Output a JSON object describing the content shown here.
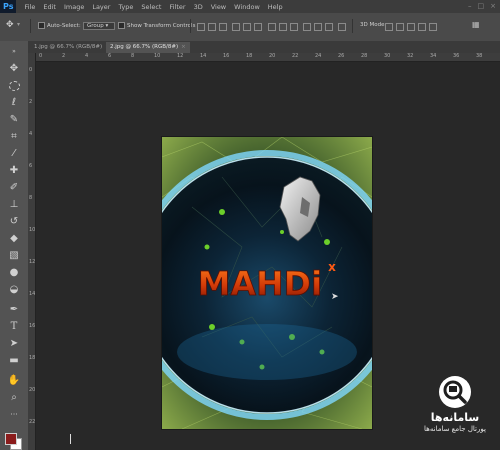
{
  "menubar": {
    "logo": "Ps",
    "items": [
      "File",
      "Edit",
      "Image",
      "Layer",
      "Type",
      "Select",
      "Filter",
      "3D",
      "View",
      "Window",
      "Help"
    ]
  },
  "options": {
    "auto_select_label": "Auto-Select:",
    "auto_select_value": "Group",
    "show_transform_label": "Show Transform Controls",
    "mode_3d_label": "3D Mode:"
  },
  "tabs": [
    {
      "label": "1.jpg @ 66.7% (RGB/8#)",
      "active": false
    },
    {
      "label": "2.jpg @ 66.7% (RGB/8#)",
      "active": true
    }
  ],
  "ruler": {
    "top_ticks": [
      "0",
      "2",
      "4",
      "6",
      "8",
      "10",
      "12",
      "14",
      "16",
      "18",
      "20",
      "22",
      "24",
      "26",
      "28",
      "30",
      "32",
      "34",
      "36",
      "38"
    ],
    "left_ticks": [
      "0",
      "2",
      "4",
      "6",
      "8",
      "10",
      "12",
      "14",
      "16",
      "18",
      "20",
      "22"
    ]
  },
  "artwork": {
    "text": "MAHDi",
    "superscript": "x"
  },
  "watermark": {
    "title": "سامانه‌ها",
    "subtitle": "پورتال جامع سامانه‌ها"
  },
  "colors": {
    "foreground": "#8b1c1c",
    "background": "#ffffff"
  },
  "tools": [
    "move-icon",
    "marquee-icon",
    "lasso-icon",
    "quick-select-icon",
    "crop-icon",
    "eyedropper-icon",
    "healing-icon",
    "brush-icon",
    "stamp-icon",
    "history-brush-icon",
    "eraser-icon",
    "gradient-icon",
    "blur-icon",
    "dodge-icon",
    "pen-icon",
    "type-icon",
    "path-select-icon",
    "shape-icon",
    "hand-icon",
    "zoom-icon"
  ]
}
